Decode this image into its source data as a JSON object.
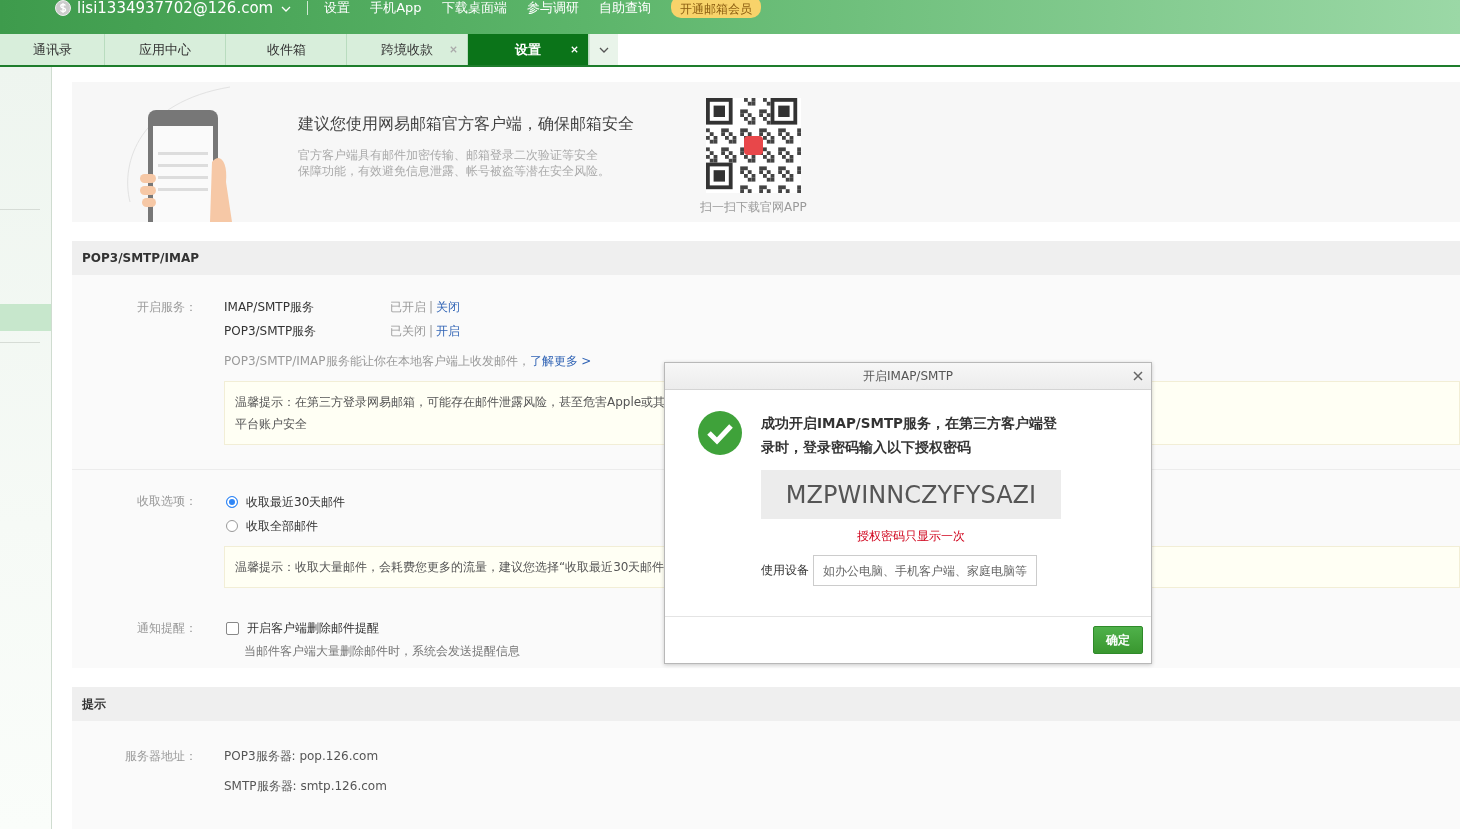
{
  "top_bar": {
    "account": "lisi1334937702@126.com",
    "links": [
      "设置",
      "手机App",
      "下载桌面端",
      "参与调研",
      "自助查询"
    ],
    "vip_button": "开通邮箱会员"
  },
  "tabs": [
    {
      "label": "通讯录",
      "selected": false,
      "closable": false
    },
    {
      "label": "应用中心",
      "selected": false,
      "closable": false
    },
    {
      "label": "收件箱",
      "selected": false,
      "closable": false
    },
    {
      "label": "跨境收款",
      "selected": false,
      "closable": true
    },
    {
      "label": "设置",
      "selected": true,
      "closable": true
    }
  ],
  "banner": {
    "title": "建议您使用网易邮箱官方客户端，确保邮箱安全",
    "description": [
      "官方客户端具有邮件加密传输、邮箱登录二次验证等安全",
      "保障功能，有效避免信息泄露、帐号被盗等潜在安全风险。"
    ],
    "qr_caption": "扫一扫下载官网APP"
  },
  "pop_section": {
    "title": "POP3/SMTP/IMAP",
    "service_label": "开启服务：",
    "services": [
      {
        "name": "IMAP/SMTP服务",
        "status": "已开启",
        "separator": "|",
        "action": "关闭"
      },
      {
        "name": "POP3/SMTP服务",
        "status": "已关闭",
        "separator": "|",
        "action": "开启"
      }
    ],
    "info": "POP3/SMTP/IMAP服务能让你在本地客户端上收发邮件，",
    "info_link": "了解更多 >",
    "tip": [
      "温馨提示：在第三方登录网易邮箱，可能存在邮件泄露风险，甚至危害Apple或其",
      "平台账户安全"
    ],
    "receive_label": "收取选项：",
    "receive_options": [
      {
        "label": "收取最近30天邮件",
        "selected": true
      },
      {
        "label": "收取全部邮件",
        "selected": false
      }
    ],
    "receive_tip": "温馨提示：收取大量邮件，会耗费您更多的流量，建议您选择“收取最近30天邮件",
    "notify_label": "通知提醒：",
    "notify": {
      "label": "开启客户端删除邮件提醒",
      "checked": false,
      "description": "当邮件客户端大量删除邮件时，系统会发送提醒信息"
    }
  },
  "hint_section": {
    "title": "提示",
    "label": "服务器地址：",
    "servers": [
      "POP3服务器: pop.126.com",
      "SMTP服务器: smtp.126.com"
    ]
  },
  "dialog": {
    "title": "开启IMAP/SMTP",
    "message": "成功开启IMAP/SMTP服务，在第三方客户端登录时，登录密码输入以下授权密码",
    "code": "MZPWINNCZYFYSAZI",
    "warning": "授权密码只显示一次",
    "device_label": "使用设备",
    "device_placeholder": "如办公电脑、手机客户端、家庭电脑等",
    "ok_button": "确定"
  }
}
